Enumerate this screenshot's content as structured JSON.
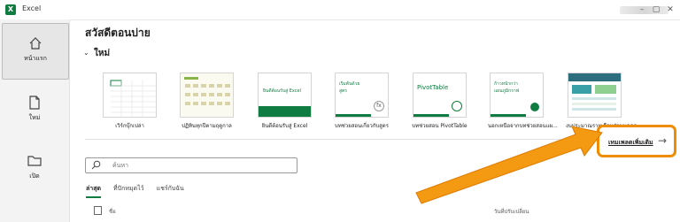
{
  "app": {
    "name": "Excel",
    "icon": "excel-icon",
    "brand_color": "#107c41"
  },
  "sidebar": {
    "items": [
      {
        "label": "หน้าแรก",
        "icon": "home-icon",
        "active": true
      },
      {
        "label": "ใหม่",
        "icon": "new-file-icon",
        "active": false
      },
      {
        "label": "เปิด",
        "icon": "folder-icon",
        "active": false
      }
    ]
  },
  "main": {
    "title": "สวัสดีตอนบ่าย",
    "new_section": {
      "label": "ใหม่",
      "chevron": "chevron-down-icon"
    },
    "templates": [
      {
        "label": "เวิร์กบุ๊กเปล่า"
      },
      {
        "label": "ปฏิทินทุกปีตามฤดูกาล"
      },
      {
        "label": "ยินดีต้อนรับสู่ Excel",
        "thumb_text": "ยินดีต้อนรับสู่ Excel"
      },
      {
        "label": "บทช่วยสอนเกี่ยวกับสูตร",
        "thumb_text": "เริ่มต้นด้วย สูตร"
      },
      {
        "label": "บทช่วยสอน PivotTable",
        "thumb_text": "PivotTable"
      },
      {
        "label": "นอกเหนือจากบทช่วยสอนแผ...",
        "thumb_text": "ก้าวหน้ากว่า แผนภูมิกราฟ"
      },
      {
        "label": "งบประมาณรายเดือนส่วนบุคคล"
      }
    ],
    "more_templates_label": "เทมเพลตเพิ่มเติม",
    "accent_color": "#f08c00",
    "search": {
      "placeholder": "ค้นหา"
    },
    "tabs": [
      {
        "label": "ล่าสุด",
        "active": true
      },
      {
        "label": "ที่ปักหมุดไว้",
        "active": false
      },
      {
        "label": "แชร์กับฉัน",
        "active": false
      }
    ],
    "list_headers": {
      "name": "ชื่อ",
      "modified": "วันที่ปรับเปลี่ยน"
    }
  }
}
